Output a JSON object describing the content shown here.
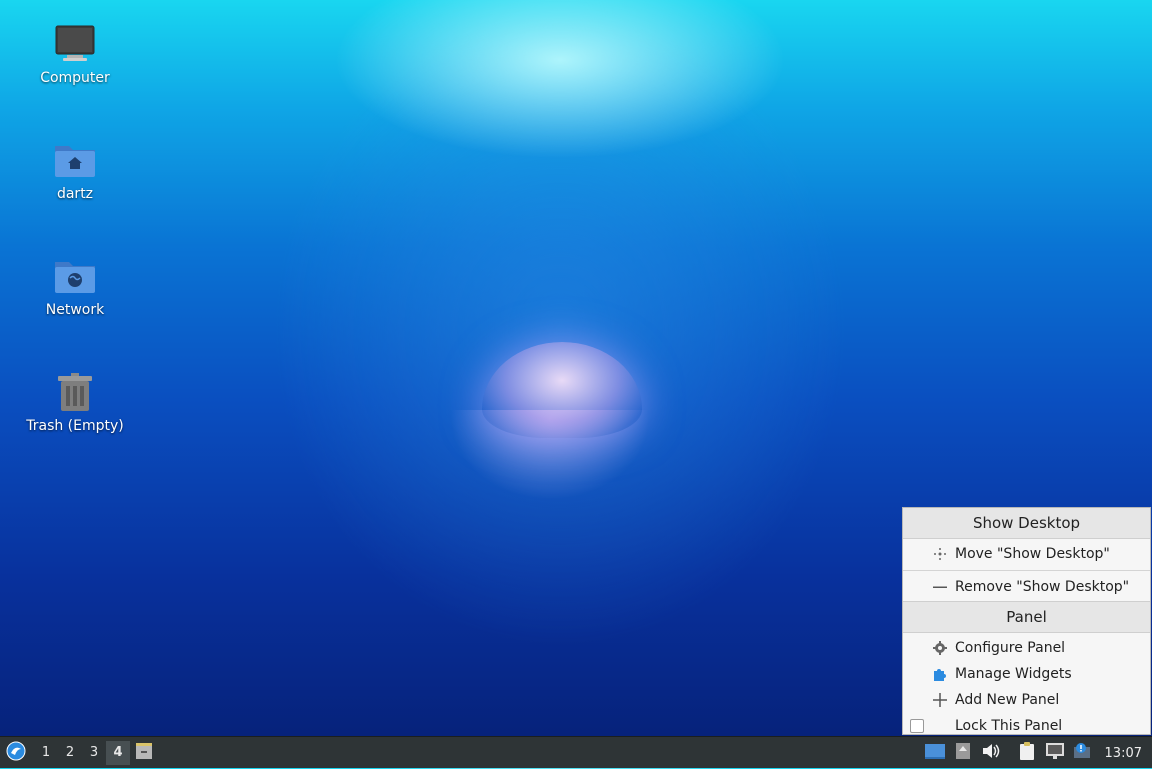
{
  "desktop": {
    "icons": [
      {
        "label": "Computer",
        "icon": "monitor-icon"
      },
      {
        "label": "dartz",
        "icon": "home-folder-icon"
      },
      {
        "label": "Network",
        "icon": "network-folder-icon"
      },
      {
        "label": "Trash (Empty)",
        "icon": "trash-icon"
      }
    ]
  },
  "taskbar": {
    "workspaces": [
      "1",
      "2",
      "3",
      "4"
    ],
    "active_workspace": "4",
    "clock": "13:07"
  },
  "context_menu": {
    "section1_title": "Show Desktop",
    "move_label": "Move \"Show Desktop\"",
    "remove_label": "Remove \"Show Desktop\"",
    "section2_title": "Panel",
    "configure_label": "Configure Panel",
    "manage_label": "Manage Widgets",
    "add_label": "Add New Panel",
    "lock_label": "Lock This Panel"
  },
  "colors": {
    "accent": "#2b8be0",
    "taskbar_bg": "#2e3436"
  }
}
